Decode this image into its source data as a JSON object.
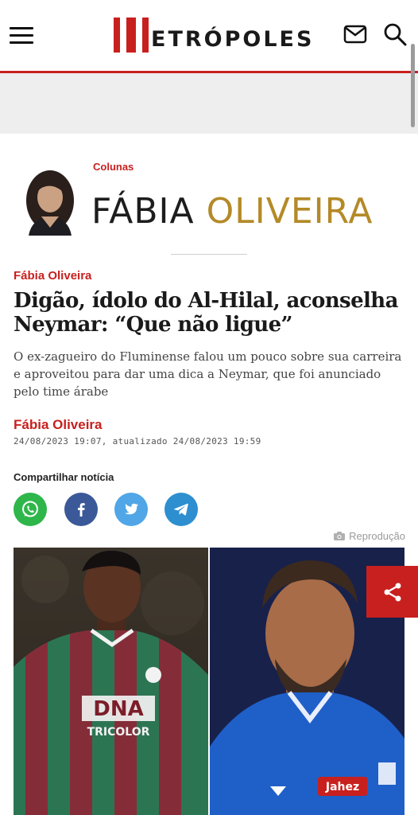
{
  "header": {
    "logo_text": "ETRÓPOLES",
    "menu_icon": "hamburger-menu-icon",
    "mail_icon": "mail-icon",
    "search_icon": "search-icon",
    "accent_color": "#c8201e"
  },
  "column": {
    "label": "Colunas",
    "first_name": "FÁBIA",
    "last_name": "OLIVEIRA",
    "name_colors": {
      "first": "#1d1d1d",
      "last": "#b48a28"
    }
  },
  "article": {
    "category": "Fábia Oliveira",
    "headline": "Digão, ídolo do Al-Hilal, aconselha Neymar: “Que não ligue”",
    "summary": "O ex-zagueiro do Fluminense falou um pouco sobre sua carreira e aproveitou para dar uma dica a Neymar, que foi anunciado pelo time árabe",
    "author": "Fábia Oliveira",
    "date": "24/08/2023 19:07, atualizado 24/08/2023 19:59"
  },
  "share": {
    "label": "Compartilhar notícia",
    "buttons": [
      {
        "name": "whatsapp",
        "icon": "whatsapp-icon",
        "color": "#2fb64a"
      },
      {
        "name": "facebook",
        "icon": "facebook-icon",
        "color": "#3b5998"
      },
      {
        "name": "twitter",
        "icon": "twitter-icon",
        "color": "#50a6e6"
      },
      {
        "name": "telegram",
        "icon": "telegram-icon",
        "color": "#2d8fd0"
      }
    ]
  },
  "photo": {
    "credit": "Reprodução",
    "left_jersey_text": "DNA",
    "left_jersey_sub": "TRICOLOR",
    "right_sponsor": "Jahez"
  }
}
